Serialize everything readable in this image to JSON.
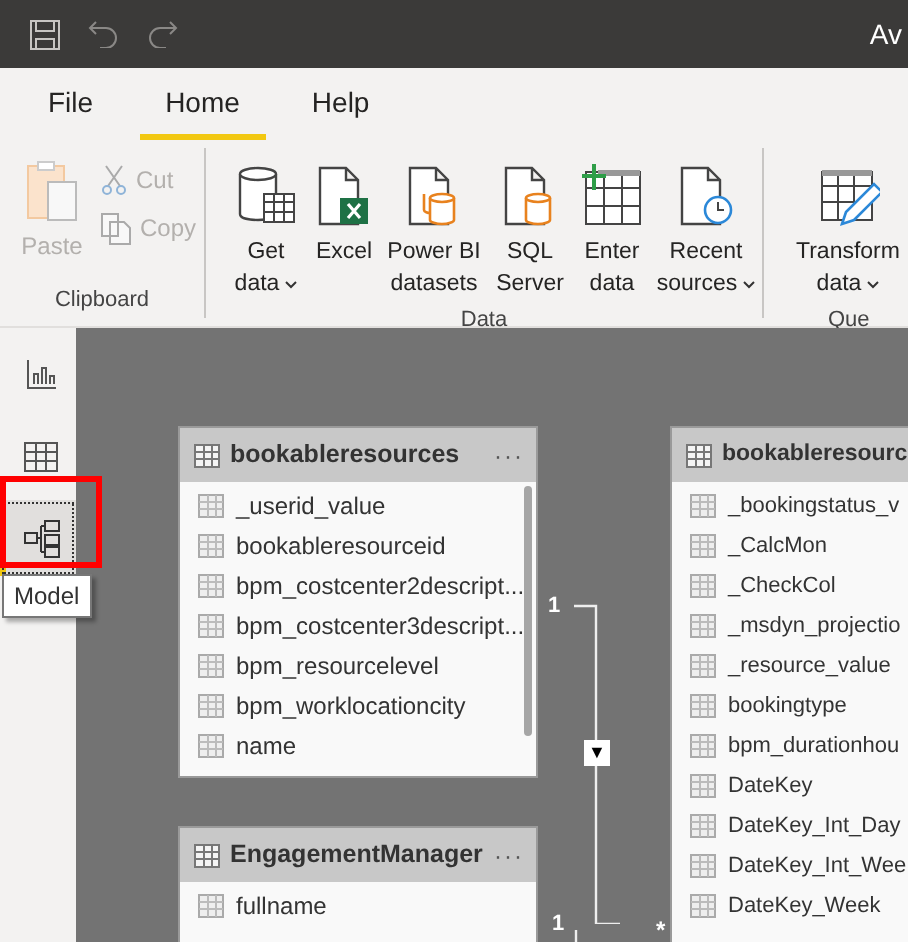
{
  "title_bar": {
    "title": "Av"
  },
  "ribbon_tabs": [
    {
      "label": "File",
      "selected": false
    },
    {
      "label": "Home",
      "selected": true
    },
    {
      "label": "Help",
      "selected": false
    }
  ],
  "clipboard": {
    "label": "Clipboard",
    "paste": {
      "label": "Paste",
      "disabled": true
    },
    "small_buttons": [
      {
        "kind": "cut",
        "label": "Cut",
        "disabled": true
      },
      {
        "kind": "copy",
        "label": "Copy",
        "disabled": true
      }
    ]
  },
  "data_group": {
    "label": "Data",
    "buttons": [
      {
        "kind": "get-data",
        "lines": [
          "Get",
          "data"
        ],
        "dropdown": true
      },
      {
        "kind": "excel",
        "lines": [
          "Excel"
        ],
        "dropdown": false
      },
      {
        "kind": "powerbi",
        "lines": [
          "Power BI",
          "datasets"
        ],
        "dropdown": false
      },
      {
        "kind": "sql",
        "lines": [
          "SQL",
          "Server"
        ],
        "dropdown": false
      },
      {
        "kind": "enter-data",
        "lines": [
          "Enter",
          "data"
        ],
        "dropdown": false
      },
      {
        "kind": "recent",
        "lines": [
          "Recent",
          "sources"
        ],
        "dropdown": true
      }
    ]
  },
  "queries_group": {
    "label": "Que",
    "buttons": [
      {
        "kind": "transform",
        "lines": [
          "Transform",
          "data"
        ],
        "dropdown": true
      }
    ]
  },
  "view_rail": [
    {
      "kind": "report",
      "selected": false
    },
    {
      "kind": "data",
      "selected": false
    },
    {
      "kind": "model",
      "selected": true
    }
  ],
  "tooltip": "Model",
  "tables": [
    {
      "name": "bookableresources",
      "menu": "···",
      "scrollbar": true,
      "fields": [
        "_userid_value",
        "bookableresourceid",
        "bpm_costcenter2descript...",
        "bpm_costcenter3descript...",
        "bpm_resourcelevel",
        "bpm_worklocationcity",
        "name"
      ]
    },
    {
      "name": "EngagementManager",
      "menu": "···",
      "fields": [
        "fullname"
      ]
    },
    {
      "name": "bookableresourc",
      "fields": [
        "_bookingstatus_v",
        "_CalcMon",
        "_CheckCol",
        "_msdyn_projectio",
        "_resource_value",
        "bookingtype",
        "bpm_durationhou",
        "DateKey",
        "DateKey_Int_Day",
        "DateKey_Int_Wee",
        "DateKey_Week"
      ]
    }
  ],
  "relationships": [
    {
      "from_card": "1",
      "to_card": "*",
      "direction": "▼"
    },
    {
      "from_card": "1"
    }
  ]
}
